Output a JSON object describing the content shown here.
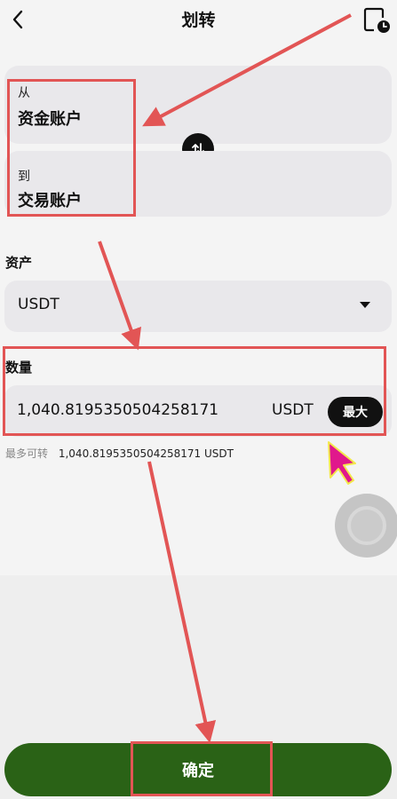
{
  "header": {
    "title": "划转",
    "back_icon": "chevron-left-icon",
    "record_icon": "clock-document-icon"
  },
  "from": {
    "label": "从",
    "account": "资金账户"
  },
  "to": {
    "label": "到",
    "account": "交易账户"
  },
  "swap_icon": "swap-arrows-icon",
  "asset": {
    "label": "资产",
    "selected": "USDT"
  },
  "amount": {
    "label": "数量",
    "value": "1,040.8195350504258171",
    "unit": "USDT",
    "max_label": "最大"
  },
  "available": {
    "label": "最多可转",
    "value": "1,040.8195350504258171 USDT"
  },
  "confirm_label": "确定",
  "colors": {
    "confirm_bg": "#2a6216",
    "annotation": "#e25555",
    "pointer": "#e0188c"
  }
}
